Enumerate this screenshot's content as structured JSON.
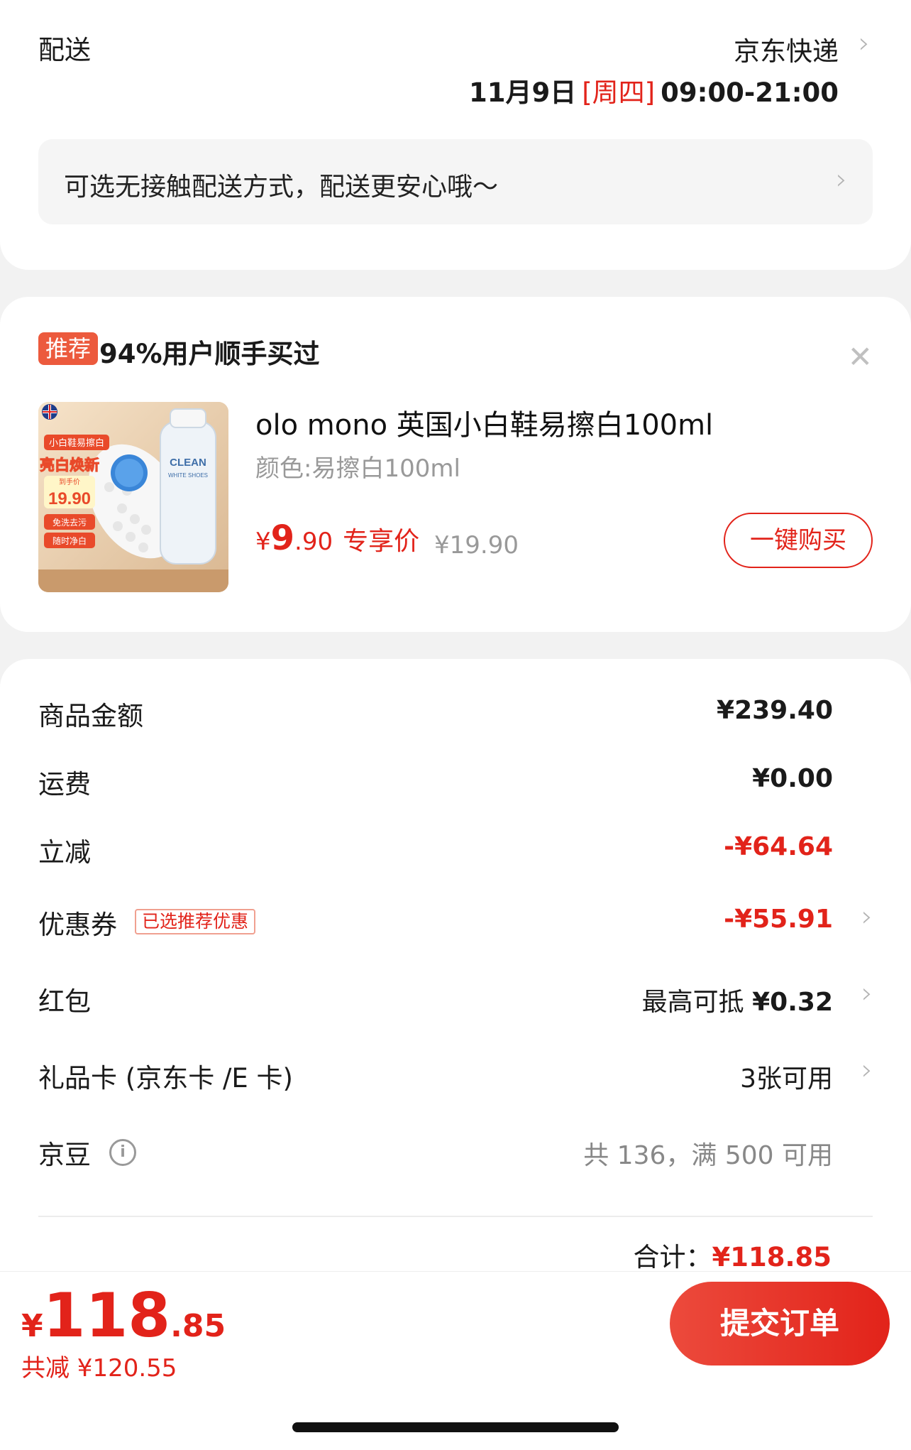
{
  "delivery": {
    "label": "配送",
    "carrier": "京东快递",
    "date": "11月9日",
    "weekday": "[周四]",
    "time": "09:00-21:00",
    "contactless_text": "可选无接触配送方式，配送更安心哦～"
  },
  "recommend": {
    "tag": "推荐",
    "title": "94%用户顺手买过",
    "product": {
      "name": "olo mono 英国小白鞋易擦白100ml",
      "spec": "颜色:易擦白100ml",
      "price_currency": "¥",
      "price_int": "9",
      "price_dec": ".90",
      "price_label": "专享价",
      "original_price": "¥19.90",
      "buy_label": "一键购买",
      "image_texts": {
        "banner": "小白鞋易擦白",
        "headline": "亮白焕新",
        "price_label": "到手价",
        "price": "19.90",
        "feature1": "免洗去污",
        "feature2": "随时净白",
        "bottle_brand": "CLEAN",
        "bottle_sub": "WHITE SHOES"
      }
    }
  },
  "cost": {
    "rows": [
      {
        "label": "商品金额",
        "value": "¥239.40"
      },
      {
        "label": "运费",
        "value": "¥0.00"
      },
      {
        "label": "立减",
        "value": "-¥64.64"
      },
      {
        "label": "优惠券",
        "badge": "已选推荐优惠",
        "value": "-¥55.91"
      },
      {
        "label": "红包",
        "value_prefix": "最高可抵 ",
        "value": "¥0.32"
      },
      {
        "label": "礼品卡 (京东卡 /E 卡)",
        "value": "3张可用"
      },
      {
        "label": "京豆",
        "value": "共 136，满 500 可用"
      }
    ],
    "subtotal_label": "合计：",
    "subtotal_value": "¥118.85"
  },
  "bottom": {
    "currency": "¥",
    "total_int": "118",
    "total_dec": ".85",
    "saved": "共减 ¥120.55",
    "submit_label": "提交订单"
  },
  "colors": {
    "accent": "#e2231a",
    "tag_bg": "#ec5a3d"
  },
  "icons": {
    "chevron": "chevron-right-icon",
    "close": "close-icon",
    "info": "info-icon"
  }
}
